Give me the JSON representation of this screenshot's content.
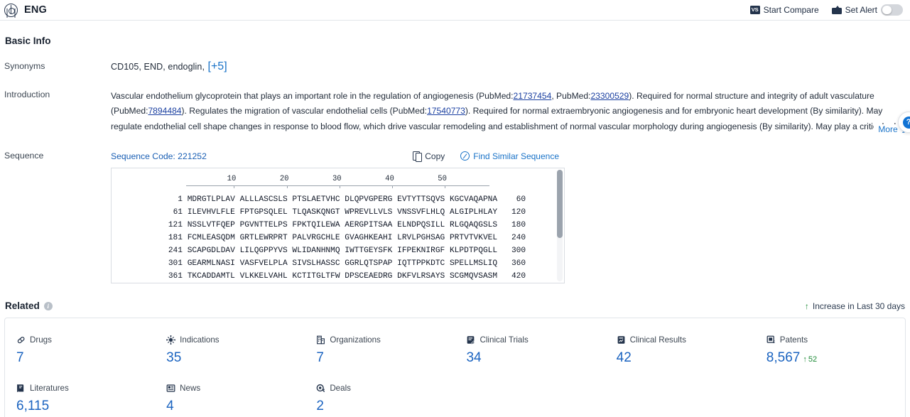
{
  "header": {
    "entity_name": "ENG",
    "entity_icon": "target-crosshair-icon",
    "start_compare": "Start Compare",
    "start_compare_icon": "versus-icon",
    "set_alert": "Set Alert",
    "set_alert_icon": "alert-envelope-icon",
    "alert_toggle_state": "off"
  },
  "basic_info": {
    "section_title": "Basic Info",
    "synonyms_label": "Synonyms",
    "synonyms_value": "CD105, END, endoglin,",
    "synonyms_more": "[+5]",
    "introduction_label": "Introduction",
    "introduction_parts": [
      {
        "t": "Vascular endothelium glycoprotein that plays an important role in the regulation of angiogenesis (PubMed:"
      },
      {
        "t": "21737454",
        "link": true
      },
      {
        "t": ", PubMed:"
      },
      {
        "t": "23300529",
        "link": true
      },
      {
        "t": "). Required for normal structure and integrity of adult vasculature (PubMed:"
      },
      {
        "t": "7894484",
        "link": true
      },
      {
        "t": "). Regulates the migration of vascular endothelial cells (PubMed:"
      },
      {
        "t": "17540773",
        "link": true
      },
      {
        "t": "). Required for normal extraembryonic angiogenesis and for embryonic heart development (By similarity). May regulate endothelial cell shape changes in response to blood flow, which drive vascular remodeling and establishment of normal vascular morphology during angiogenesis (By similarity). May play a critical role in the binding of endothelial cells to integrins a"
      }
    ],
    "more_label": "More",
    "more_icon": "chevron-expand-icon"
  },
  "sequence": {
    "label": "Sequence",
    "code_label": "Sequence Code: 221252",
    "copy_label": "Copy",
    "copy_icon": "copy-icon",
    "find_label": "Find Similar Sequence",
    "find_icon": "search-circle-icon",
    "ruler_ticks": [
      10,
      20,
      30,
      40,
      50
    ],
    "lines": [
      {
        "start": "1",
        "blocks": [
          "MDRGTLPLAV",
          "ALLLASCSLS",
          "PTSLAETVHC",
          "DLQPVGPERG",
          "EVTYTTSQVS",
          "KGCVAQAPNA"
        ],
        "end": "60"
      },
      {
        "start": "61",
        "blocks": [
          "ILEVHVLFLE",
          "FPTGPSQLEL",
          "TLQASKQNGT",
          "WPREVLLVLS",
          "VNSSVFLHLQ",
          "ALGIPLHLAY"
        ],
        "end": "120"
      },
      {
        "start": "121",
        "blocks": [
          "NSSLVTFQEP",
          "PGVNTTELPS",
          "FPKTQILEWA",
          "AERGPITSAA",
          "ELNDPQSILL",
          "RLGQAQGSLS"
        ],
        "end": "180"
      },
      {
        "start": "181",
        "blocks": [
          "FCMLEASQDM",
          "GRTLEWRPRT",
          "PALVRGCHLE",
          "GVAGHKEAHI",
          "LRVLPGHSAG",
          "PRTVTVKVEL"
        ],
        "end": "240"
      },
      {
        "start": "241",
        "blocks": [
          "SCAPGDLDAV",
          "LILQGPPYVS",
          "WLIDANHNMQ",
          "IWTTGEYSFK",
          "IFPEKNIRGF",
          "KLPDTPQGLL"
        ],
        "end": "300"
      },
      {
        "start": "301",
        "blocks": [
          "GEARMLNASI",
          "VASFVELPLA",
          "SIVSLHASSC",
          "GGRLQTSPAP",
          "IQTTPPKDTC",
          "SPELLMSLIQ"
        ],
        "end": "360"
      },
      {
        "start": "361",
        "blocks": [
          "TKCADDAMTL",
          "VLKKELVAHL",
          "KCTITGLTFW",
          "DPSCEAEDRG",
          "DKFVLRSAYS",
          "SCGMQVSASM"
        ],
        "end": "420"
      }
    ]
  },
  "related": {
    "title": "Related",
    "info_icon": "info-icon",
    "legend_text": "Increase in Last 30 days",
    "legend_icon": "up-arrow-icon",
    "cards": [
      {
        "label": "Drugs",
        "icon": "capsule-icon",
        "value": "7"
      },
      {
        "label": "Indications",
        "icon": "virus-icon",
        "value": "35"
      },
      {
        "label": "Organizations",
        "icon": "building-icon",
        "value": "7"
      },
      {
        "label": "Clinical Trials",
        "icon": "clipboard-icon",
        "value": "34"
      },
      {
        "label": "Clinical Results",
        "icon": "results-icon",
        "value": "42"
      },
      {
        "label": "Patents",
        "icon": "patent-icon",
        "value": "8,567",
        "delta": "52",
        "delta_dir": "up"
      },
      {
        "label": "Literatures",
        "icon": "book-icon",
        "value": "6,115"
      },
      {
        "label": "News",
        "icon": "newspaper-icon",
        "value": "4"
      },
      {
        "label": "Deals",
        "icon": "handshake-icon",
        "value": "2"
      }
    ]
  },
  "floating": {
    "help_icon": "help-bubble-icon"
  }
}
